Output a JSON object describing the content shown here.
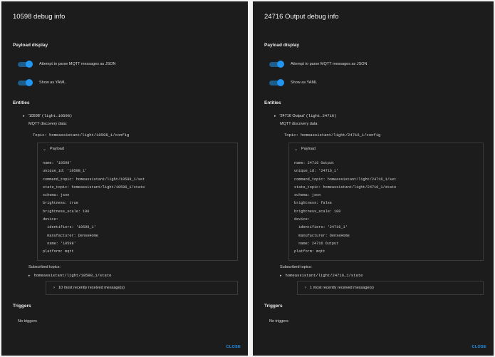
{
  "accent": "#2196f3",
  "left": {
    "title": "10598 debug info",
    "payload_display": "Payload display",
    "toggle_json": "Attempt to parse MQTT messages as JSON",
    "toggle_yaml": "Show as YAML",
    "entities": "Entities",
    "entity_name": "'10598'",
    "entity_id": "(light.10598)",
    "discovery": "MQTT discovery data:",
    "topic": "Topic: homeassistant/light/10598_1/config",
    "payload": "Payload",
    "payload_text": "name: '10598'\nunique_id: '10598_1'\ncommand_topic: homeassistant/light/10598_1/set\nstate_topic: homeassistant/light/10598_1/state\nschema: json\nbrightness: true\nbrightness_scale: 100\ndevice:\n  identifiers: '10598_1'\n  manufacturer: DenseHome\n  name: '10598'\nplatform: mqtt",
    "subscribed": "Subscribed topics:",
    "sub_topic": "homeassistant/light/10598_1/state",
    "messages": "10 most recently received message(s)",
    "triggers": "Triggers",
    "no_triggers": "No triggers",
    "close": "CLOSE"
  },
  "right": {
    "title": "24716 Output debug info",
    "payload_display": "Payload display",
    "toggle_json": "Attempt to parse MQTT messages as JSON",
    "toggle_yaml": "Show as YAML",
    "entities": "Entities",
    "entity_name": "'24716 Output'",
    "entity_id": "(light.24716)",
    "discovery": "MQTT discovery data:",
    "topic": "Topic: homeassistant/light/24716_1/config",
    "payload": "Payload",
    "payload_text": "name: 24716 Output\nunique_id: '24716_1'\ncommand_topic: homeassistant/light/24716_1/set\nstate_topic: homeassistant/light/24716_1/state\nschema: json\nbrightness: false\nbrightness_scale: 100\ndevice:\n  identifiers: '24716_1'\n  manufacturer: DenseHome\n  name: 24716 Output\nplatform: mqtt",
    "subscribed": "Subscribed topics:",
    "sub_topic": "homeassistant/light/24716_1/state",
    "messages": "1 most recently received message(s)",
    "triggers": "Triggers",
    "no_triggers": "No triggers",
    "close": "CLOSE"
  }
}
